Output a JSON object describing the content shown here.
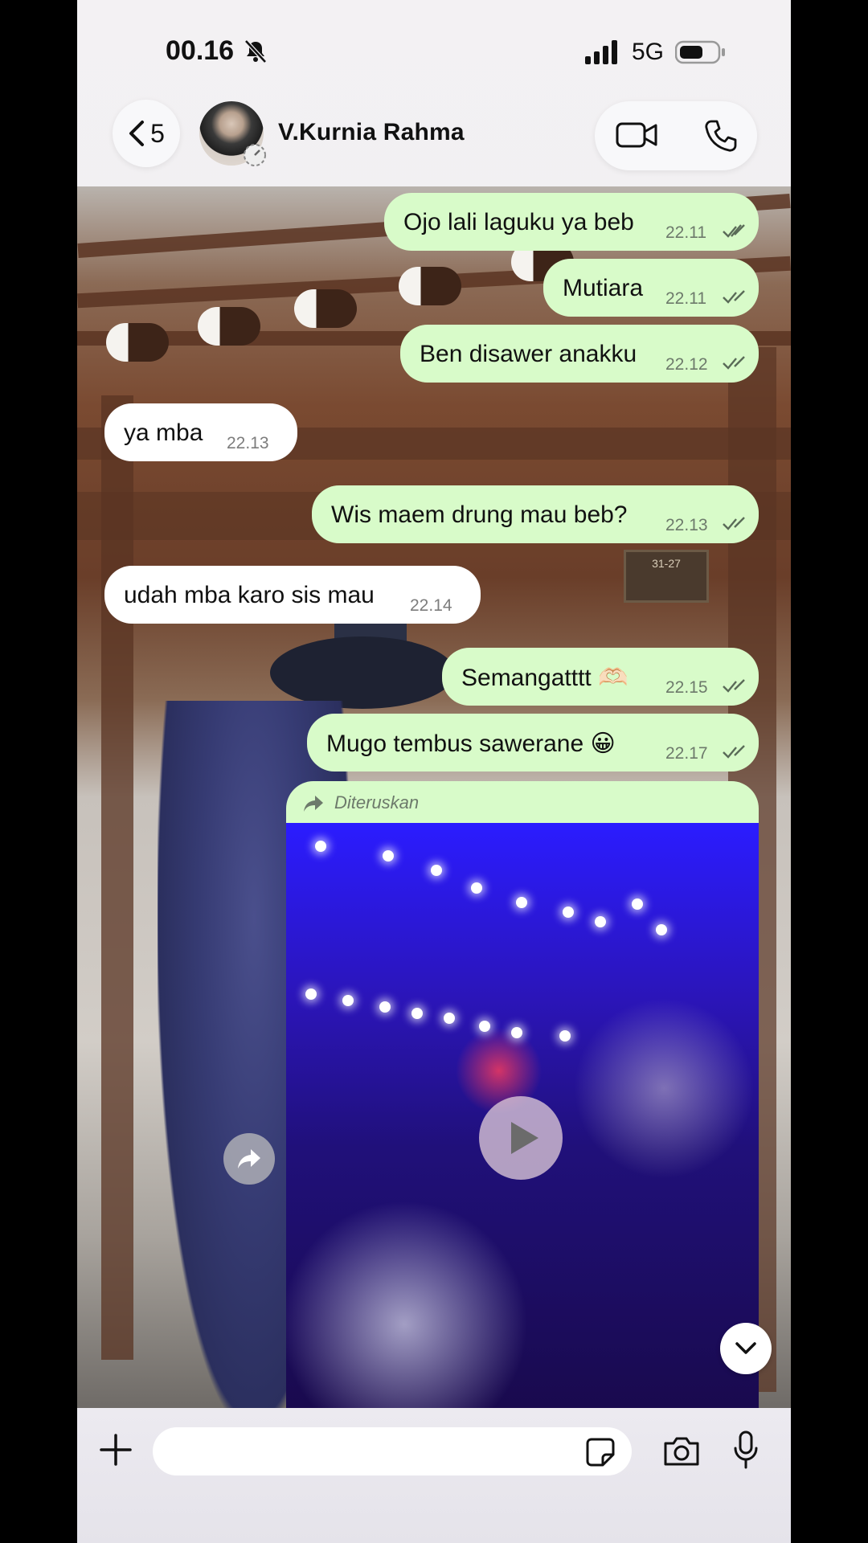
{
  "status": {
    "time": "00.16",
    "network": "5G"
  },
  "header": {
    "back_count": "5",
    "contact_name": "V.Kurnia Rahma"
  },
  "messages": [
    {
      "dir": "out",
      "text": "Ojo lali laguku ya beb",
      "time": "22.11",
      "read": true
    },
    {
      "dir": "out",
      "text": "Mutiara",
      "time": "22.11",
      "read": true
    },
    {
      "dir": "out",
      "text": "Ben disawer anakku",
      "time": "22.12",
      "read": true
    },
    {
      "dir": "in",
      "text": "ya mba",
      "time": "22.13"
    },
    {
      "dir": "out",
      "text": "Wis maem drung mau beb?",
      "time": "22.13",
      "read": true
    },
    {
      "dir": "in",
      "text": "udah mba karo sis mau",
      "time": "22.14"
    },
    {
      "dir": "out",
      "text": "Semangatttt 🫶🏻",
      "time": "22.15",
      "read": true
    },
    {
      "dir": "out",
      "text": "Mugo tembus sawerane 😀",
      "time": "22.17",
      "read": true
    }
  ],
  "forwarded": {
    "label": "Diteruskan"
  },
  "input": {
    "placeholder": ""
  },
  "icons": {
    "bell": "bell-slash-icon",
    "signal": "signal-icon",
    "battery": "battery-icon",
    "back": "chevron-left-icon",
    "video": "video-camera-icon",
    "phone": "phone-icon",
    "forward": "forward-arrow-icon",
    "play": "play-icon",
    "share": "share-icon",
    "scroll": "chevron-down-icon",
    "plus": "plus-icon",
    "sticker": "sticker-icon",
    "camera": "camera-icon",
    "mic": "microphone-icon"
  },
  "colors": {
    "outgoing_bubble": "#d8fbc9",
    "incoming_bubble": "#ffffff",
    "ticks": "#5a6b58"
  }
}
